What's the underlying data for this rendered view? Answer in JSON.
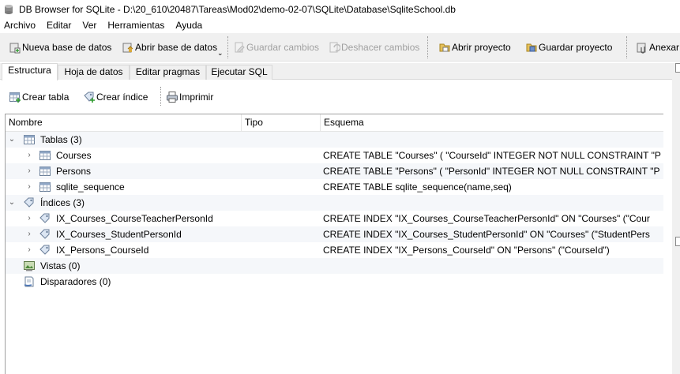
{
  "window": {
    "title": "DB Browser for SQLite - D:\\20_610\\20487\\Tareas\\Mod02\\demo-02-07\\SQLite\\Database\\SqliteSchool.db"
  },
  "menu": [
    "Archivo",
    "Editar",
    "Ver",
    "Herramientas",
    "Ayuda"
  ],
  "toolbar": {
    "new_db": "Nueva base de datos",
    "open_db": "Abrir base de datos",
    "dropdown_arrow": "⌄",
    "write_changes": "Guardar cambios",
    "revert_changes": "Deshacer cambios",
    "open_project": "Abrir proyecto",
    "save_project": "Guardar proyecto",
    "attach_db": "Anexar b"
  },
  "tabs": [
    "Estructura",
    "Hoja de datos",
    "Editar pragmas",
    "Ejecutar SQL"
  ],
  "active_tab": "Estructura",
  "structure_toolbar": {
    "create_table": "Crear tabla",
    "create_index": "Crear índice",
    "print": "Imprimir"
  },
  "tree": {
    "columns": [
      "Nombre",
      "Tipo",
      "Esquema"
    ],
    "rows": [
      {
        "name": "Tablas (3)",
        "type": "",
        "schema": ""
      },
      {
        "name": "Courses",
        "type": "",
        "schema": "CREATE TABLE \"Courses\" ( \"CourseId\" INTEGER NOT NULL CONSTRAINT \"P"
      },
      {
        "name": "Persons",
        "type": "",
        "schema": "CREATE TABLE \"Persons\" ( \"PersonId\" INTEGER NOT NULL CONSTRAINT \"P"
      },
      {
        "name": "sqlite_sequence",
        "type": "",
        "schema": "CREATE TABLE sqlite_sequence(name,seq)"
      },
      {
        "name": "Índices (3)",
        "type": "",
        "schema": ""
      },
      {
        "name": "IX_Courses_CourseTeacherPersonId",
        "type": "",
        "schema": "CREATE INDEX \"IX_Courses_CourseTeacherPersonId\" ON \"Courses\" (\"Cour"
      },
      {
        "name": "IX_Courses_StudentPersonId",
        "type": "",
        "schema": "CREATE INDEX \"IX_Courses_StudentPersonId\" ON \"Courses\" (\"StudentPers"
      },
      {
        "name": "IX_Persons_CourseId",
        "type": "",
        "schema": "CREATE INDEX \"IX_Persons_CourseId\" ON \"Persons\" (\"CourseId\")"
      },
      {
        "name": "Vistas (0)",
        "type": "",
        "schema": ""
      },
      {
        "name": "Disparadores (0)",
        "type": "",
        "schema": ""
      }
    ]
  },
  "colors": {
    "toolbar_bg": "#f0f0f0",
    "row_alt": "#f5f7fa",
    "disabled_text": "#a0a0a0"
  }
}
